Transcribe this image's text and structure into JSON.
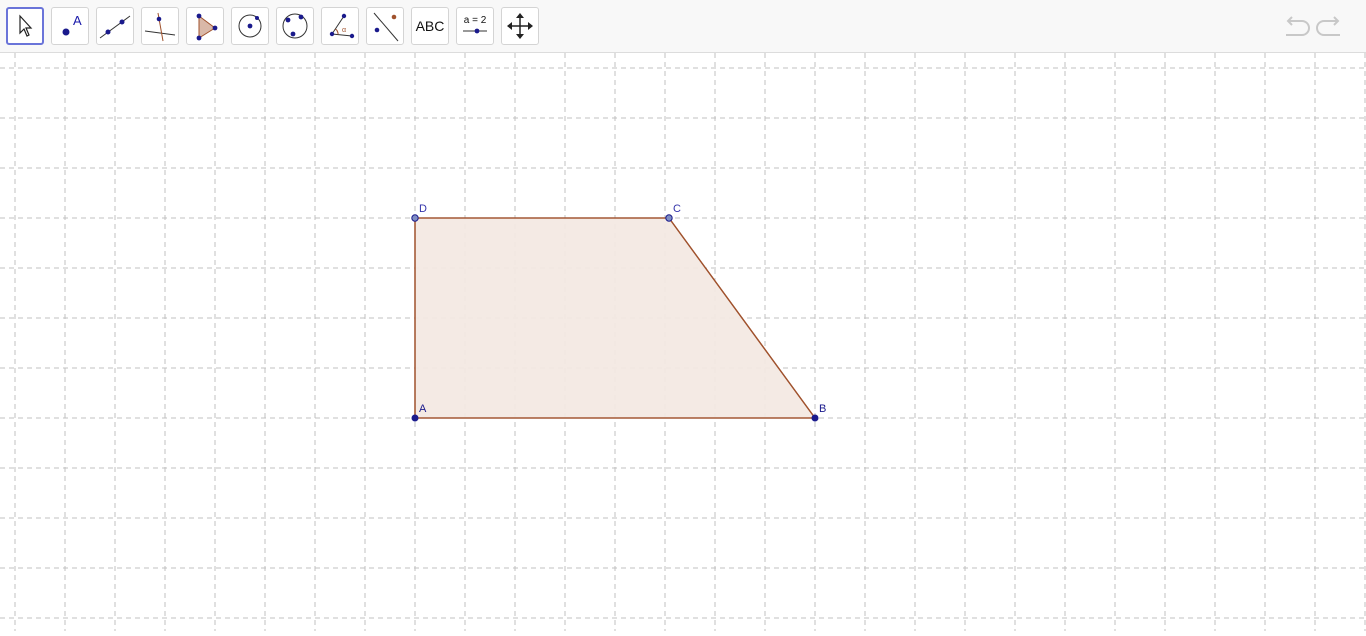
{
  "toolbar": {
    "tools": [
      {
        "name": "move",
        "icon": "arrow-cursor-icon",
        "selected": true
      },
      {
        "name": "point",
        "icon": "point-icon"
      },
      {
        "name": "line",
        "icon": "line-icon"
      },
      {
        "name": "perpendicular-line",
        "icon": "perpendicular-line-icon"
      },
      {
        "name": "polygon",
        "icon": "polygon-icon"
      },
      {
        "name": "circle-center-point",
        "icon": "circle-center-icon"
      },
      {
        "name": "circle-three-points",
        "icon": "circle-three-points-icon"
      },
      {
        "name": "angle",
        "icon": "angle-icon"
      },
      {
        "name": "reflect-about-line",
        "icon": "reflect-icon"
      },
      {
        "name": "text",
        "icon": "text-icon",
        "label": "ABC"
      },
      {
        "name": "slider",
        "icon": "slider-icon",
        "label": "a = 2"
      },
      {
        "name": "move-graphics-view",
        "icon": "move-view-icon"
      }
    ],
    "undo_icon": "undo-icon",
    "redo_icon": "redo-icon"
  },
  "graphics": {
    "grid": "dashed",
    "points": {
      "A": "A",
      "B": "B",
      "C": "C",
      "D": "D"
    },
    "colors": {
      "point": "#1a1a8c",
      "label": "#3333aa",
      "polygon_stroke": "#a0522d",
      "polygon_fill": "#f3e9e3",
      "grid": "#c0c0c0"
    }
  }
}
